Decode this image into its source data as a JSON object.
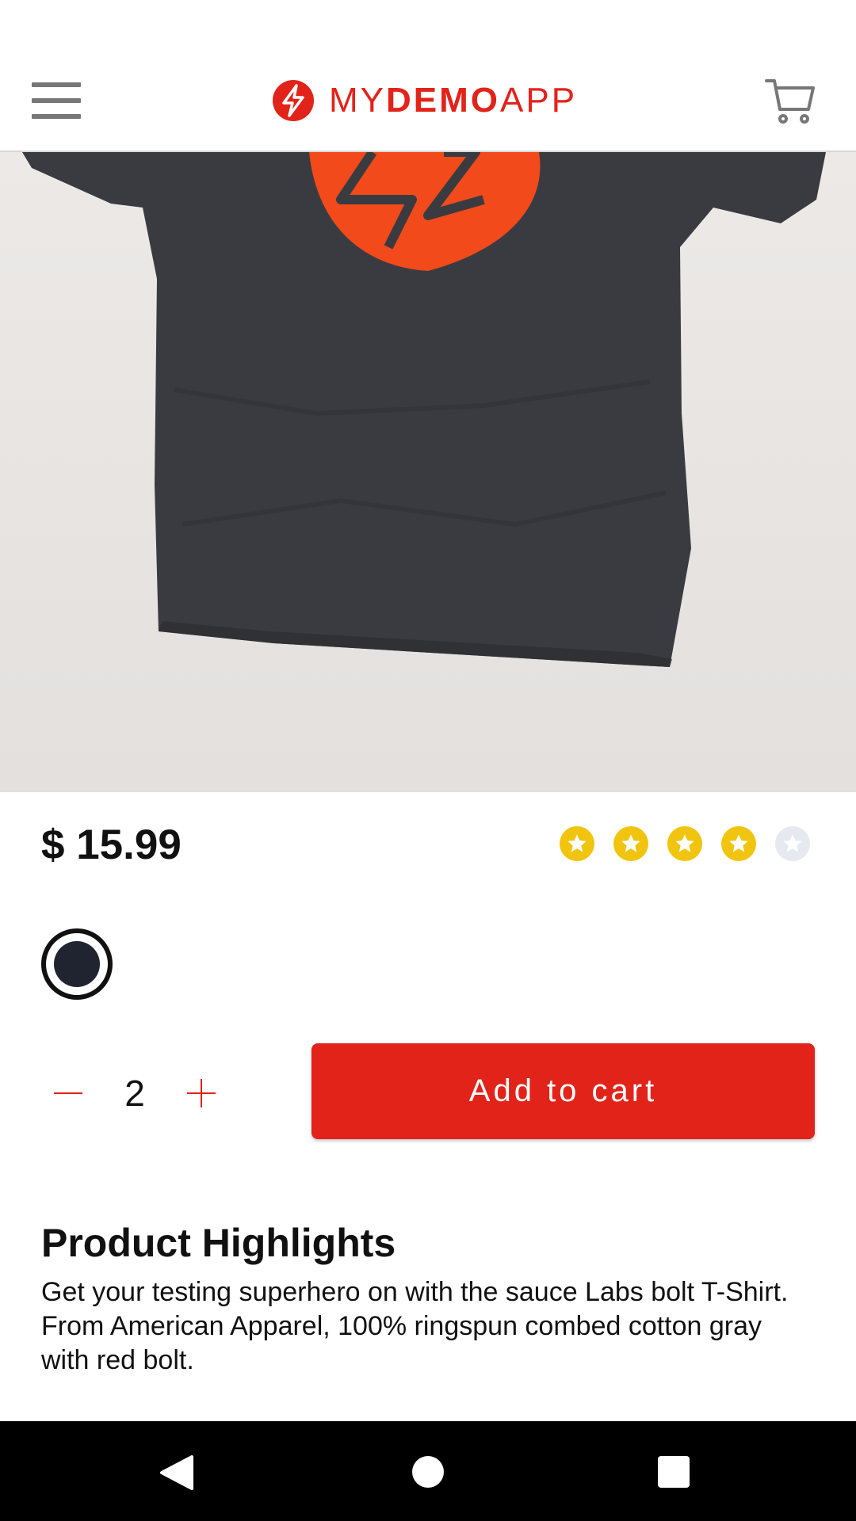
{
  "app": {
    "logo": {
      "brand_part1": "MY",
      "brand_part2": "DEMO",
      "brand_part3": "APP"
    },
    "icons": {
      "menu": "hamburger-menu-icon",
      "cart": "shopping-cart-icon",
      "logo": "bolt-logo-icon"
    }
  },
  "product": {
    "image_alt": "Sauce Labs bolt T-Shirt",
    "price": "$ 15.99",
    "rating": 4,
    "rating_max": 5,
    "colors": [
      "#1f2430"
    ],
    "selected_color_name": "black"
  },
  "quantity": {
    "value": "2"
  },
  "actions": {
    "add_to_cart": "Add to cart"
  },
  "highlights": {
    "title": "Product Highlights",
    "description": "Get your testing superhero on with the sauce Labs bolt T-Shirt. From American Apparel, 100% ringspun combed cotton gray with red bolt."
  },
  "colors": {
    "accent": "#e2231a",
    "star_filled": "#f1c40f",
    "star_empty": "#e6e9ef",
    "shirt": "#3a3b40",
    "background_photo": "#e8e5e3"
  }
}
